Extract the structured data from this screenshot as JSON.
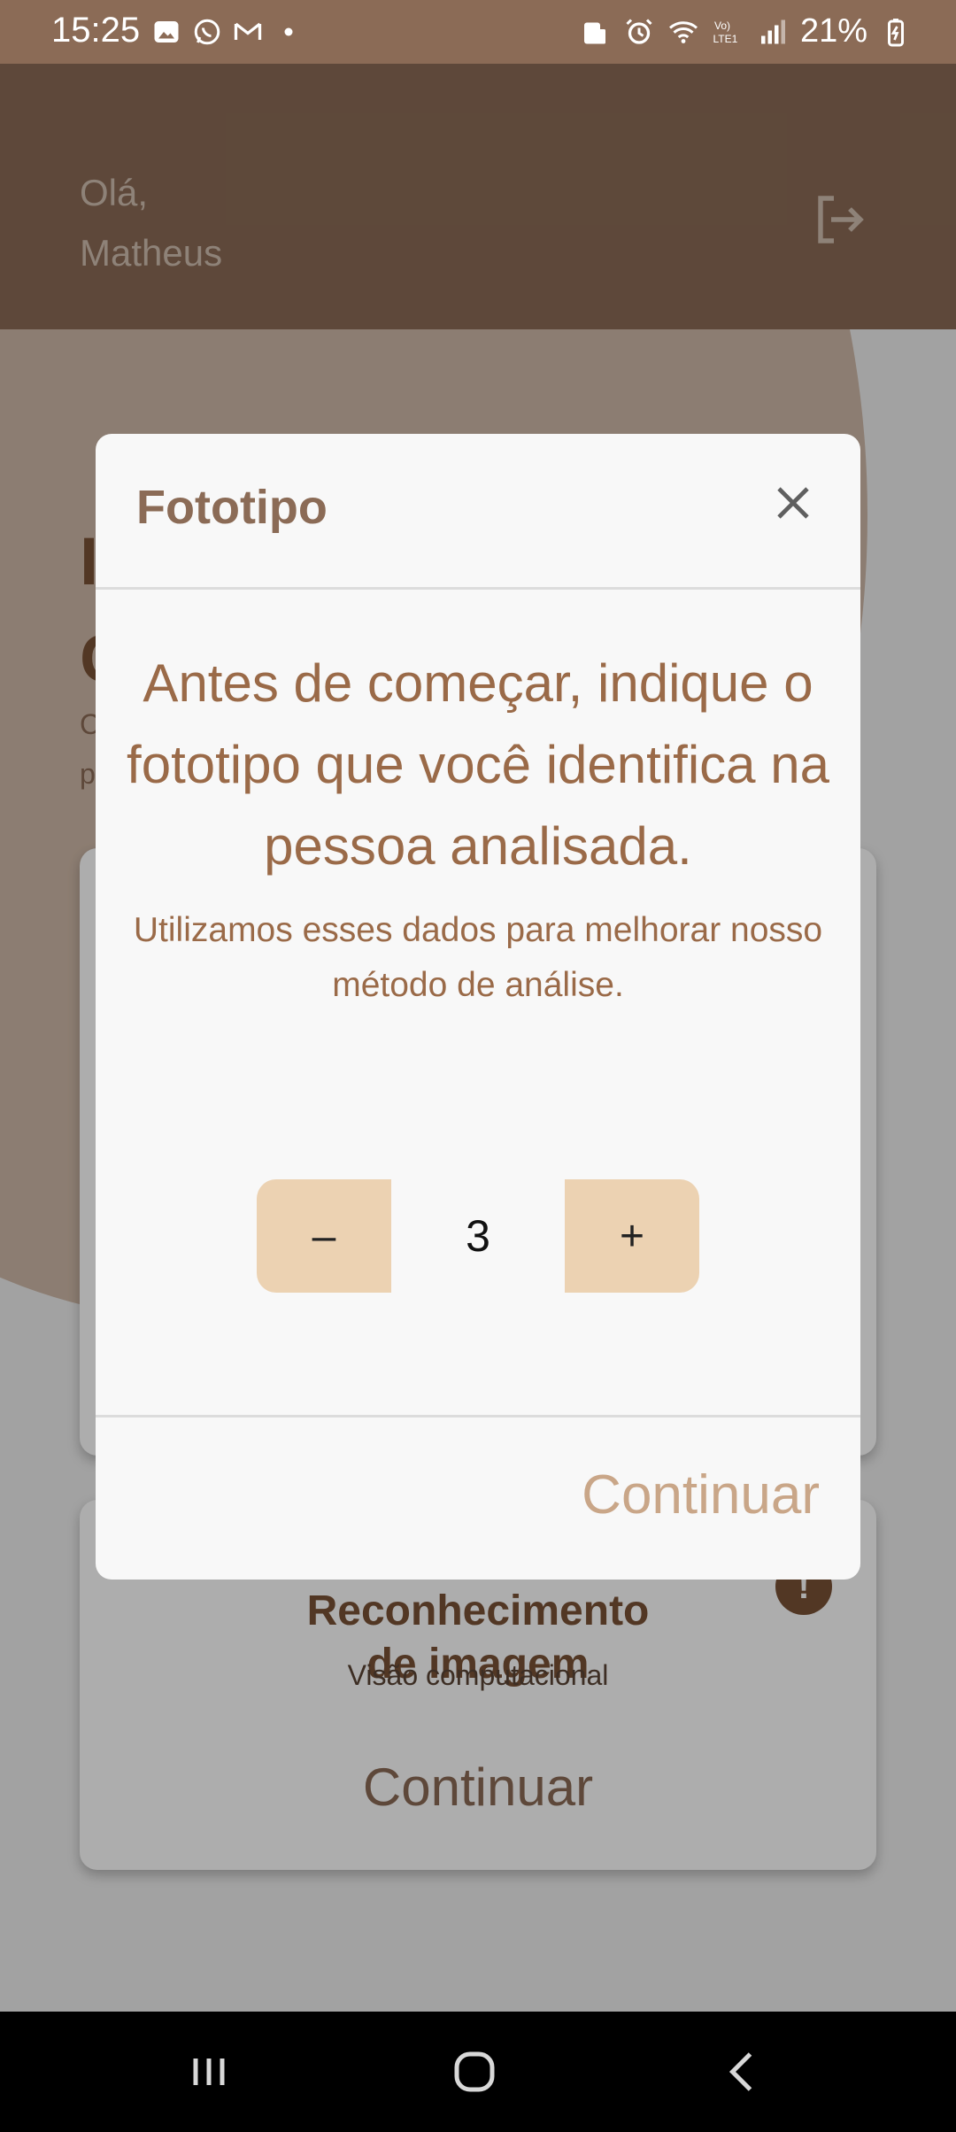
{
  "status_bar": {
    "time": "15:25",
    "battery": "21%",
    "network_label": "LTE1"
  },
  "header": {
    "greeting_line1": "Olá,",
    "greeting_line2": "Matheus"
  },
  "background": {
    "title_line1": "I",
    "title_line2": "C",
    "sub_line1": "C",
    "sub_line2": "p",
    "card2_title_line1": "Reconhecimento",
    "card2_title_line2": "de imagem",
    "card2_subtitle": "Visão computacional",
    "card2_button": "Continuar",
    "card2_info": "!"
  },
  "dialog": {
    "title": "Fototipo",
    "heading": "Antes de começar, indique o fototipo que você identifica na pessoa analisada.",
    "text": "Utilizamos esses dados para melhorar nosso método de análise.",
    "stepper": {
      "minus_label": "–",
      "value": "3",
      "plus_label": "+"
    },
    "continue_label": "Continuar"
  },
  "colors": {
    "brand": "#8b6b56",
    "accent_text": "#9a6a48",
    "stepper_bg": "#ecd2b2",
    "continue_disabled": "#c9a688"
  }
}
